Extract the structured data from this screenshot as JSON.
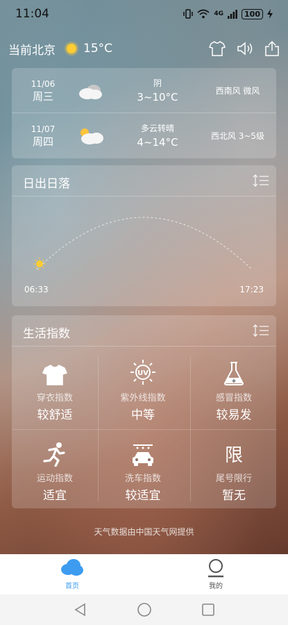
{
  "status_bar": {
    "time": "11:04",
    "signal_label": "4G",
    "battery": "100"
  },
  "header": {
    "location": "当前北京",
    "temperature": "15°C",
    "weather_icon": "sun-icon",
    "actions": [
      "shirt-icon",
      "speaker-icon",
      "share-icon"
    ]
  },
  "forecast": [
    {
      "date": "11/06",
      "weekday": "周三",
      "condition": "阴",
      "temp_range": "3~10°C",
      "wind": "西南风 微风",
      "icon": "cloud-icon"
    },
    {
      "date": "11/07",
      "weekday": "周四",
      "condition": "多云转晴",
      "temp_range": "4~14°C",
      "wind": "西北风 3~5级",
      "icon": "partly-cloudy-icon"
    }
  ],
  "sunrise_sunset": {
    "title": "日出日落",
    "sunrise": "06:33",
    "sunset": "17:23"
  },
  "life_index": {
    "title": "生活指数",
    "items": [
      {
        "icon": "shirt-icon",
        "label": "穿衣指数",
        "value": "较舒适"
      },
      {
        "icon": "uv-icon",
        "label": "紫外线指数",
        "value": "中等"
      },
      {
        "icon": "flask-icon",
        "label": "感冒指数",
        "value": "较易发"
      },
      {
        "icon": "running-icon",
        "label": "运动指数",
        "value": "适宜"
      },
      {
        "icon": "car-wash-icon",
        "label": "洗车指数",
        "value": "较适宜"
      },
      {
        "icon": "restriction-icon",
        "label": "尾号限行",
        "value": "暂无",
        "glyph": "限"
      }
    ]
  },
  "footer": {
    "source": "天气数据由中国天气网提供"
  },
  "tabs": [
    {
      "label": "首页",
      "active": true,
      "color": "#3d9cf0"
    },
    {
      "label": "我的",
      "active": false,
      "color": "#555555"
    }
  ]
}
